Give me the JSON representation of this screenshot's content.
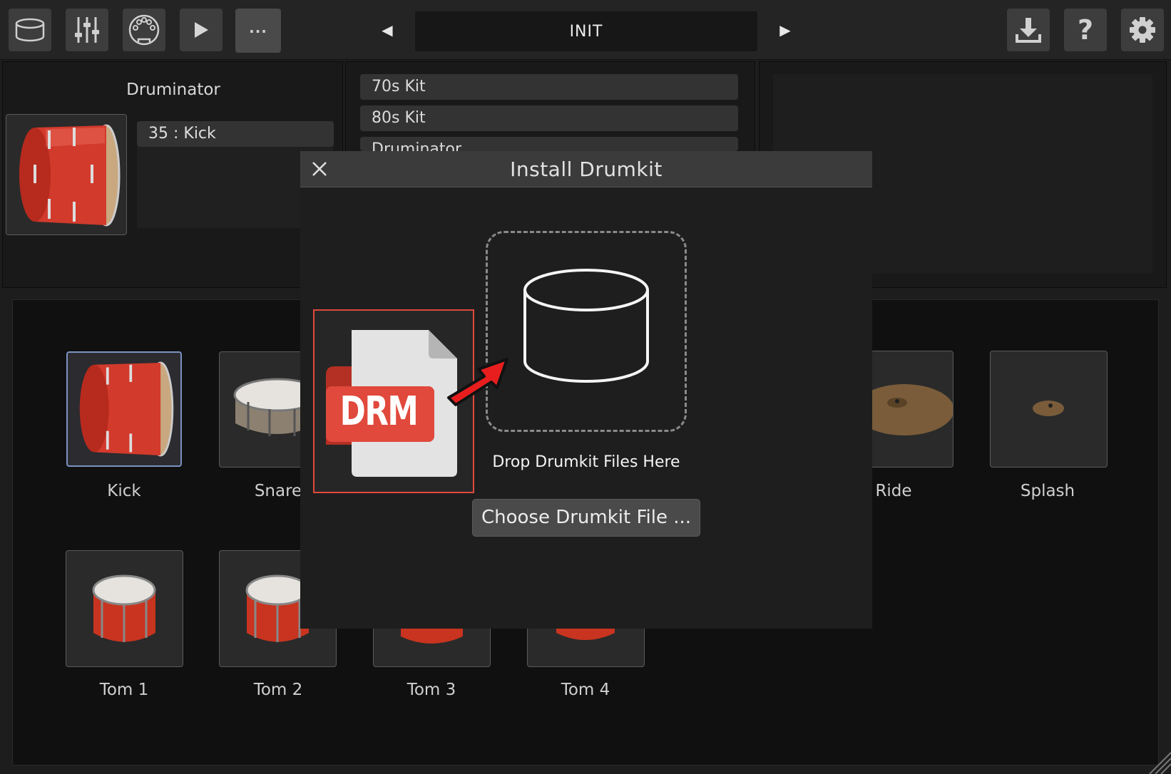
{
  "toolbar": {
    "buttons": [
      {
        "name": "drumkit-view-button",
        "icon": "drum-icon"
      },
      {
        "name": "mixer-view-button",
        "icon": "mixer-sliders-icon"
      },
      {
        "name": "midi-view-button",
        "icon": "midi-port-icon"
      },
      {
        "name": "play-button",
        "icon": "play-icon"
      },
      {
        "name": "more-button",
        "label": "..."
      }
    ],
    "preset_name": "INIT",
    "prev_preset_icon": "◀",
    "next_preset_icon": "▶",
    "right_buttons": [
      {
        "name": "install-button",
        "icon": "download-icon"
      },
      {
        "name": "help-button",
        "icon": "help-icon",
        "label": "?"
      },
      {
        "name": "settings-button",
        "icon": "gear-icon"
      }
    ]
  },
  "kit_panel": {
    "kit_name": "Druminator",
    "note_label": "35 : Kick"
  },
  "kit_list": {
    "items": [
      "70s Kit",
      "80s Kit",
      "Druminator"
    ]
  },
  "drum_grid": {
    "pads": [
      {
        "label": "Kick",
        "selected": true
      },
      {
        "label": "Snare"
      },
      {
        "label": "Ride"
      },
      {
        "label": "Splash"
      },
      {
        "label": "Tom 1"
      },
      {
        "label": "Tom 2"
      },
      {
        "label": "Tom 3"
      },
      {
        "label": "Tom 4"
      }
    ]
  },
  "modal": {
    "title": "Install Drumkit",
    "file_badge": "DRM",
    "drop_text": "Drop Drumkit Files Here",
    "choose_button": "Choose Drumkit File ..."
  },
  "colors": {
    "accent_red": "#e0493c",
    "selection_blue": "#7b93c2",
    "drum_red": "#d23a2c"
  }
}
